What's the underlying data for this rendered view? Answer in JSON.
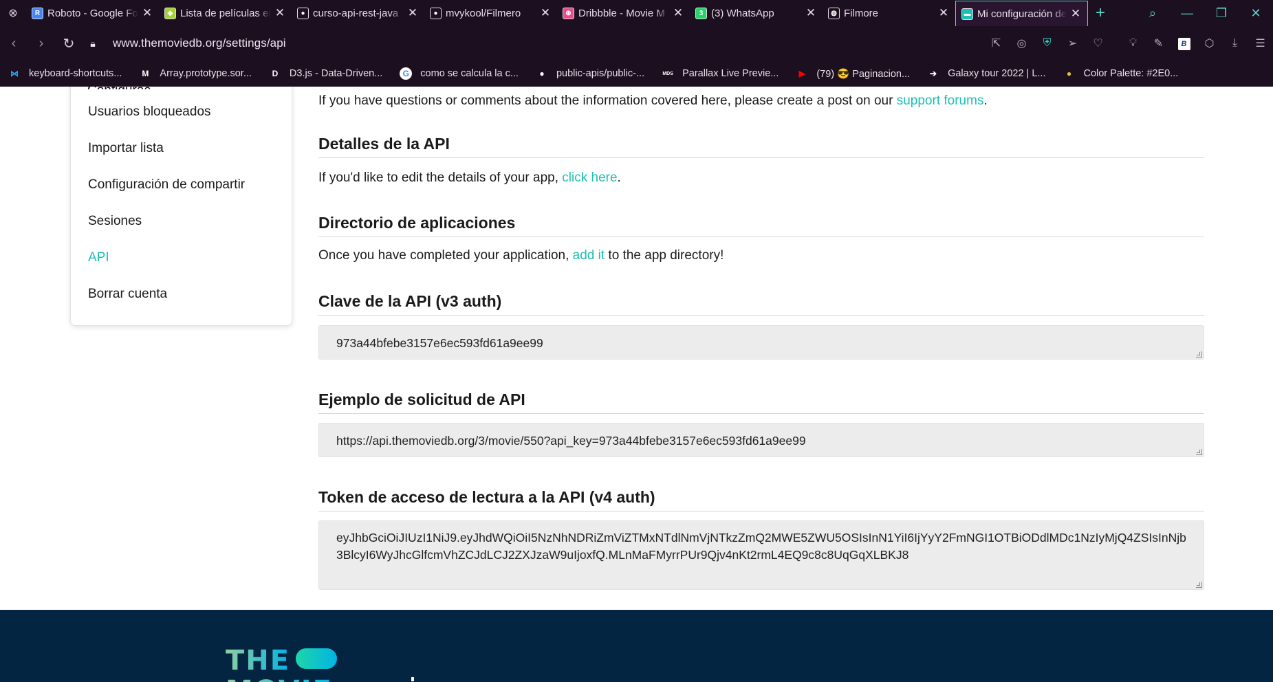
{
  "browser": {
    "tabs": [
      {
        "title": "Roboto - Google Fonts",
        "icon": "google-fonts-icon",
        "favicon_color": "#4285f4",
        "favicon_glyph": "R"
      },
      {
        "title": "Lista de películas en",
        "icon": "diamond-icon",
        "favicon_color": "#a4d233",
        "favicon_glyph": "◆"
      },
      {
        "title": "curso-api-rest-java",
        "icon": "github-icon",
        "favicon_color": "#1c0f1f",
        "favicon_glyph": "●"
      },
      {
        "title": "mvykool/Filmero",
        "icon": "github-icon",
        "favicon_color": "#1c0f1f",
        "favicon_glyph": "●"
      },
      {
        "title": "Dribbble - Movie M",
        "icon": "dribbble-icon",
        "favicon_color": "#ea4c89",
        "favicon_glyph": "⊕"
      },
      {
        "title": "(3) WhatsApp",
        "icon": "whatsapp-icon",
        "favicon_color": "#25d366",
        "favicon_glyph": "3"
      },
      {
        "title": "Filmore",
        "icon": "globe-icon",
        "favicon_color": "#1c0f1f",
        "favicon_glyph": "◍"
      },
      {
        "title": "Mi configuración de",
        "icon": "tmdb-icon",
        "favicon_color": "#1dbfb3",
        "favicon_glyph": "▬",
        "active": true
      }
    ],
    "new_tab_label": "+",
    "url_host": "www.themoviedb.org",
    "url_path": "/settings/api",
    "bookmarks": [
      {
        "label": "keyboard-shortcuts...",
        "icon": "vscode-icon",
        "color": "#22a7f0",
        "glyph": "⋈"
      },
      {
        "label": "Array.prototype.sor...",
        "icon": "mdn-icon",
        "color": "#1c0f1f",
        "glyph": "M"
      },
      {
        "label": "D3.js - Data-Driven...",
        "icon": "d3-icon",
        "color": "#1c0f1f",
        "glyph": "D"
      },
      {
        "label": "como se calcula la c...",
        "icon": "google-icon",
        "color": "#ffffff",
        "glyph": "G"
      },
      {
        "label": "public-apis/public-...",
        "icon": "github-icon",
        "color": "#1c0f1f",
        "glyph": "●"
      },
      {
        "label": "Parallax Live Previe...",
        "icon": "mds-icon",
        "color": "#1c0f1f",
        "glyph": "MDS"
      },
      {
        "label": "(79) 😎 Paginacion...",
        "icon": "youtube-icon",
        "color": "#ff0000",
        "glyph": "▶"
      },
      {
        "label": "Galaxy tour 2022 | L...",
        "icon": "arrow-icon",
        "color": "#1c0f1f",
        "glyph": "➔"
      },
      {
        "label": "Color Palette: #2E0...",
        "icon": "palette-icon",
        "color": "#e2c33a",
        "glyph": "●"
      }
    ]
  },
  "sidebar": {
    "items": [
      {
        "label": "Usuarios bloqueados"
      },
      {
        "label": "Importar lista"
      },
      {
        "label": "Configuración de compartir"
      },
      {
        "label": "Sesiones"
      },
      {
        "label": "API",
        "active": true
      },
      {
        "label": "Borrar cuenta"
      }
    ]
  },
  "content": {
    "intro_text": "If you have questions or comments about the information covered here, please create a post on our ",
    "intro_link": "support forums",
    "intro_end": ".",
    "details": {
      "heading": "Detalles de la API",
      "text": "If you'd like to edit the details of your app, ",
      "link": "click here",
      "end": "."
    },
    "directory": {
      "heading": "Directorio de aplicaciones",
      "text": "Once you have completed your application, ",
      "link": "add it",
      "end": " to the app directory!"
    },
    "api_key": {
      "heading": "Clave de la API (v3 auth)",
      "value": "973a44bfebe3157e6ec593fd61a9ee99"
    },
    "example": {
      "heading": "Ejemplo de solicitud de API",
      "value": "https://api.themoviedb.org/3/movie/550?api_key=973a44bfebe3157e6ec593fd61a9ee99"
    },
    "token": {
      "heading": "Token de acceso de lectura a la API (v4 auth)",
      "value": "eyJhbGciOiJIUzI1NiJ9.eyJhdWQiOiI5NzNhNDRiZmViZTMxNTdlNmVjNTkzZmQ2MWE5ZWU5OSIsInN1YiI6IjYyY2FmNGI1OTBiODdlMDc1NzIyMjQ4ZSIsInNjb3BlcyI6WyJhcGlfcmVhZCJdLCJ2ZXJzaW9uIjoxfQ.MLnMaFMyrrPUr9Qjv4nKt2rmL4EQ9c8c8UqGqXLBKJ8"
    }
  },
  "footer": {
    "logo_text": "THE",
    "logo_text_2": "MOVIE"
  },
  "colors": {
    "accent": "#1dbfb3",
    "footer_bg": "#032541",
    "chrome_bg": "#1c0f1f"
  }
}
